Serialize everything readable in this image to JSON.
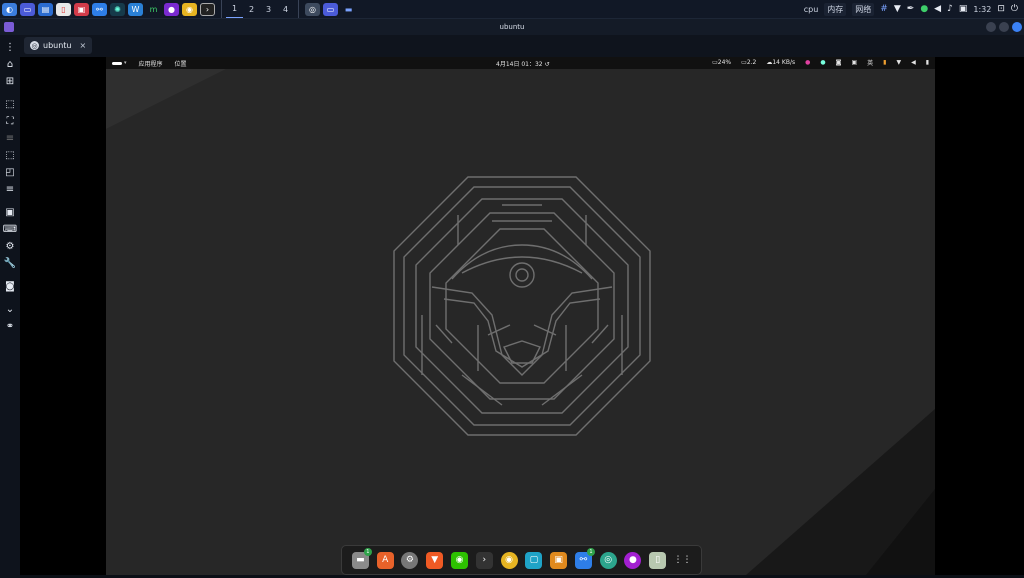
{
  "host_panel": {
    "workspaces": [
      "1",
      "2",
      "3",
      "4"
    ],
    "active_workspace": "1",
    "monitors": {
      "cpu": "cpu",
      "mem": "内存",
      "net": "网络"
    },
    "clock": "1:32"
  },
  "vm_window": {
    "title": "ubuntu",
    "tab_label": "ubuntu",
    "tab_close": "×"
  },
  "guest": {
    "top_bar": {
      "apps": "应用程序",
      "places": "位置",
      "datetime": "4月14日  01：32",
      "battery": "24%",
      "load": "2.2",
      "net_speed": "14 KB/s",
      "ime": "英"
    },
    "dock_badges": {
      "files": "1",
      "copy": "1"
    }
  },
  "colors": {
    "guest_bg": "#272727",
    "maze_stroke": "#6f6f6f",
    "accent": "#7aa2ff"
  },
  "icons": [
    "menu-icon",
    "home-icon",
    "new-window-icon",
    "fullscreen-icon",
    "settings-icon",
    "wrench-icon",
    "camera-icon",
    "chevron-down-icon",
    "link-icon",
    "wifi-icon",
    "volume-icon",
    "bell-icon",
    "lock-icon",
    "power-icon"
  ]
}
